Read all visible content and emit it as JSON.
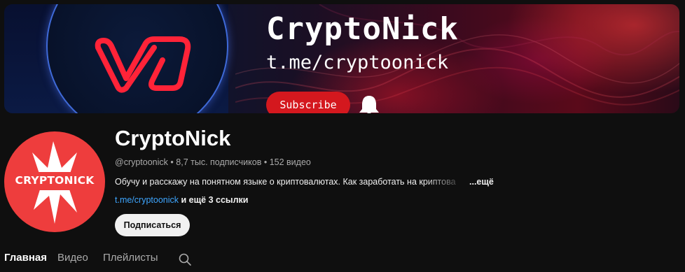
{
  "banner": {
    "title": "CryptoNick",
    "link": "t.me/cryptoonick",
    "subscribe_label": "Subscribe",
    "accent": "#d4181e"
  },
  "avatar": {
    "text": "CRYPTONICK",
    "color": "#ee3d3d"
  },
  "channel": {
    "name": "CryptoNick",
    "handle": "@cryptoonick",
    "subscribers": "8,7 тыс. подписчиков",
    "videos": "152 видео",
    "separator": "•",
    "description": "Обучу и расскажу на понятном языке о криптовалютах. Как заработать на криптова",
    "more_label": "...ещё",
    "link": "t.me/cryptoonick",
    "links_more": "и ещё 3 ссылки",
    "subscribe_label": "Подписаться"
  },
  "tabs": [
    {
      "label": "Главная",
      "active": true
    },
    {
      "label": "Видео",
      "active": false
    },
    {
      "label": "Плейлисты",
      "active": false
    }
  ],
  "icons": {
    "search": "search-icon",
    "bell": "bell-icon"
  }
}
